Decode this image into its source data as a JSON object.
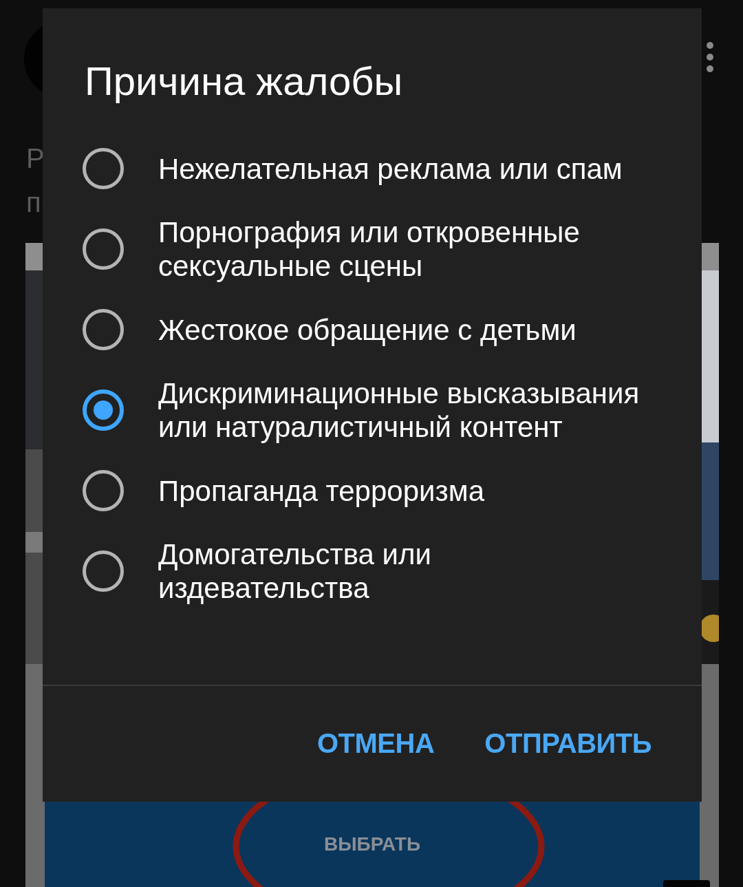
{
  "background": {
    "fragments": [
      "Р",
      "п"
    ],
    "choose_button": "ВЫБРАТЬ"
  },
  "dialog": {
    "title": "Причина жалобы",
    "options": [
      {
        "label": "Нежелательная реклама или спам",
        "selected": false
      },
      {
        "label": "Порнография или откровенные сексуальные сцены",
        "selected": false
      },
      {
        "label": "Жестокое обращение с детьми",
        "selected": false
      },
      {
        "label": "Дискриминационные высказывания или натуралистичный контент",
        "selected": true
      },
      {
        "label": "Пропаганда терроризма",
        "selected": false
      },
      {
        "label": "Домогательства или издевательства",
        "selected": false
      }
    ],
    "buttons": [
      "ОТМЕНА",
      "ОТПРАВИТЬ"
    ]
  }
}
